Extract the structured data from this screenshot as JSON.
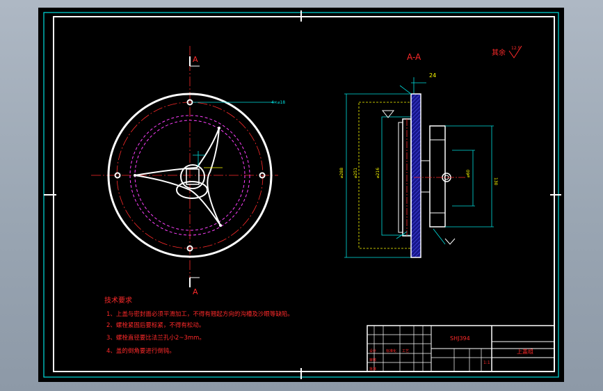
{
  "section_label": "A-A",
  "section_marks": [
    "A",
    "A"
  ],
  "roughness_note": "其余",
  "roughness_value": "12.5",
  "dim_top_width": "24",
  "tech_req": {
    "title": "技术要求",
    "items": [
      "1、上盖与密封面必须平滑加工，不得有翘起方向的沟槽及沙眼等缺陷。",
      "2、螺栓紧固后要标紧，不得有松动。",
      "3、螺栓直径要比法兰孔小2~3mm。",
      "4、盖的倒角要进行倒钝。"
    ]
  },
  "title_block": {
    "part_code": "SHJ394",
    "part_name": "上盖组",
    "cells_small": [
      "设计",
      "",
      "标准化",
      "",
      "审核",
      "",
      "工艺",
      "",
      "批准",
      ""
    ],
    "scale_label": "1:1"
  },
  "colors": {
    "frame": "#00e0e0",
    "outline": "#ffffff",
    "center": "#ff2a2a",
    "hidden": "#ff40ff",
    "dimension": "#00e0e0",
    "hatch": "#3a3ad0",
    "text": "#ff2a2a"
  }
}
